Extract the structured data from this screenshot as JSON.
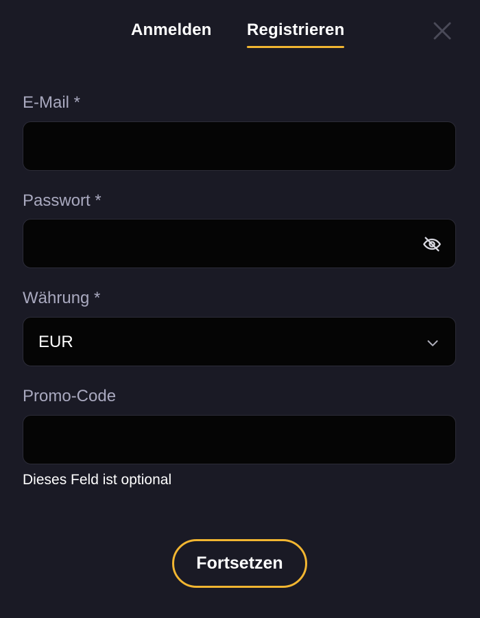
{
  "tabs": {
    "login_label": "Anmelden",
    "register_label": "Registrieren",
    "active": "register"
  },
  "close_icon": "close-icon",
  "form": {
    "email": {
      "label": "E-Mail *",
      "value": ""
    },
    "password": {
      "label": "Passwort *",
      "value": "",
      "toggle_icon": "eye-off-icon"
    },
    "currency": {
      "label": "Währung *",
      "value": "EUR",
      "icon": "chevron-down-icon"
    },
    "promo": {
      "label": "Promo-Code",
      "value": "",
      "helper": "Dieses Feld ist optional"
    }
  },
  "submit_label": "Fortsetzen",
  "colors": {
    "background": "#1a1a25",
    "field_background": "#050505",
    "accent": "#f2b631",
    "label": "#a9a9bf",
    "text": "#ffffff"
  }
}
